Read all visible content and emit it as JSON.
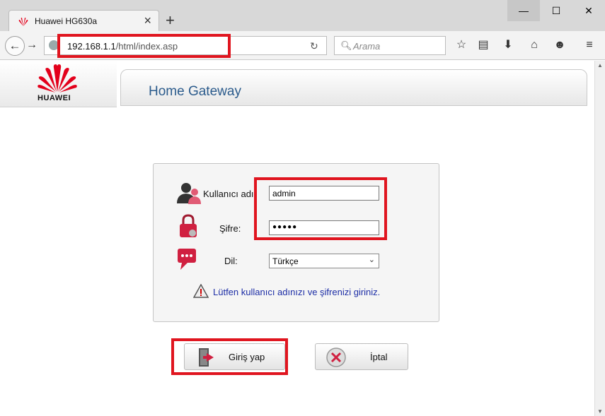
{
  "browser": {
    "tab_title": "Huawei HG630a",
    "tab_close": "×",
    "new_tab": "+",
    "window_min": "—",
    "window_max": "☐",
    "window_close": "✕",
    "url_host": "192.168.1.1",
    "url_path": "/html/index.asp",
    "search_placeholder": "Arama"
  },
  "header": {
    "brand": "HUAWEI",
    "title": "Home Gateway"
  },
  "login": {
    "username_label": "Kullanıcı adı",
    "username_value": "admin",
    "password_label": "Şifre:",
    "password_value": "●●●●●",
    "language_label": "Dil:",
    "language_selected": "Türkçe",
    "hint": "Lütfen kullanıcı adınızı ve şifrenizi giriniz."
  },
  "buttons": {
    "login": "Giriş yap",
    "cancel": "İptal"
  },
  "colors": {
    "highlight": "#e0151f",
    "title_blue": "#2b5b8c",
    "hint_blue": "#1d2ea6",
    "huawei_red": "#e3001b"
  }
}
